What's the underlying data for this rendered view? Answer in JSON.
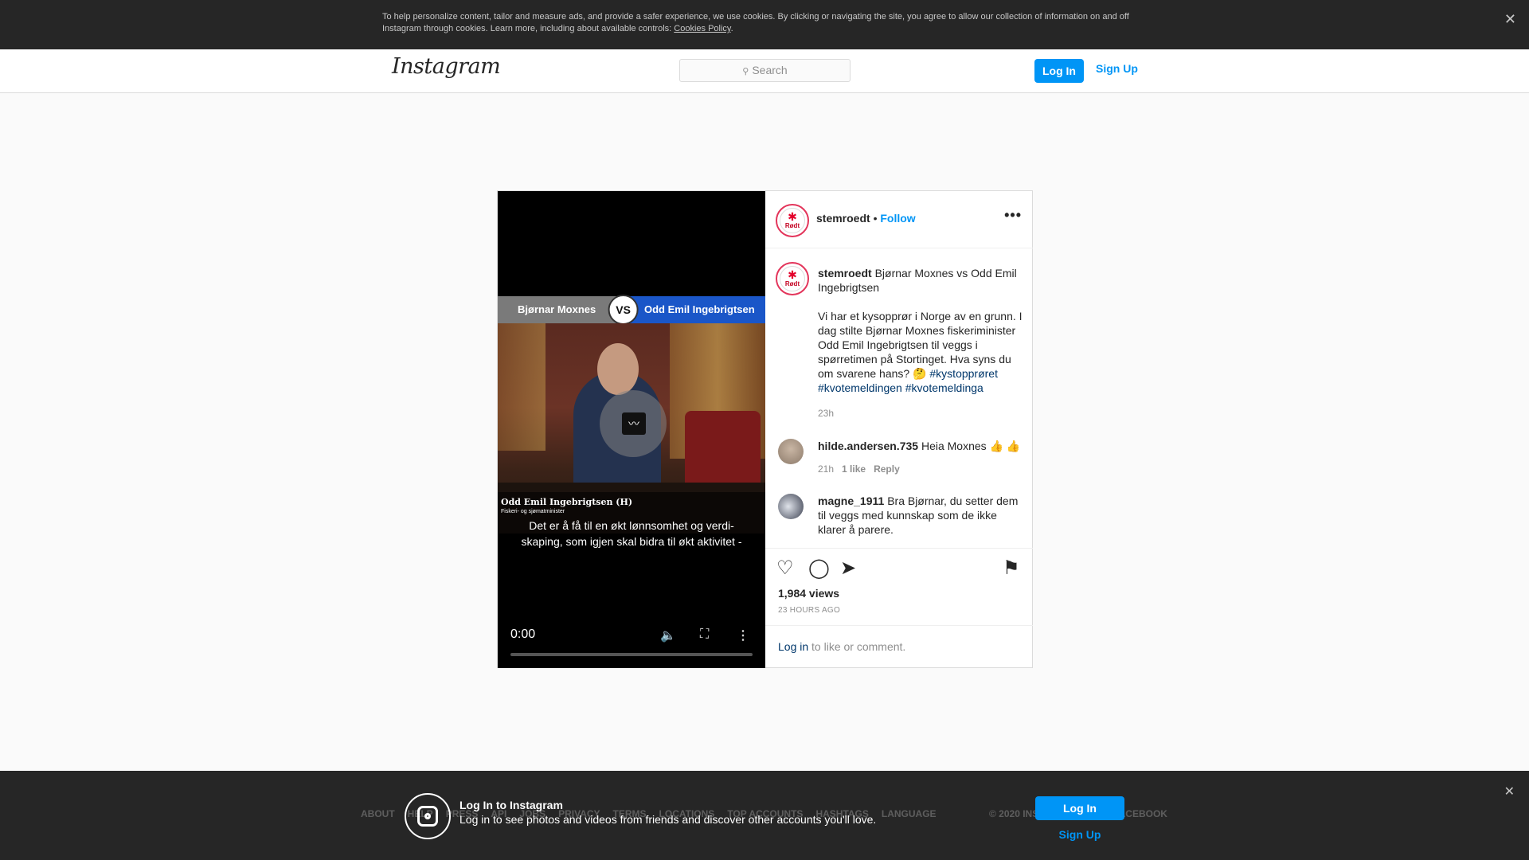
{
  "cookie_banner": {
    "text": "To help personalize content, tailor and measure ads, and provide a safer experience, we use cookies. By clicking or navigating the site, you agree to allow our collection of information on and off Instagram through cookies. Learn more, including about available controls: ",
    "link": "Cookies Policy",
    "end": ".",
    "close": "✕"
  },
  "header": {
    "logo": "Instagram",
    "search_placeholder": "Search",
    "login": "Log In",
    "signup": "Sign Up"
  },
  "video": {
    "left_name": "Bjørnar Moxnes",
    "vs": "VS",
    "right_name": "Odd Emil Ingebrigtsen",
    "lower_third_name": "Odd Emil Ingebrigtsen (H)",
    "lower_third_role": "Fiskeri- og sjømatminister",
    "subtitle": "Det er å få til en økt lønnsomhet og verdi- skaping, som igjen skal bidra til økt aktivitet -",
    "time": "0:00",
    "progress": 0
  },
  "post": {
    "username": "stemroedt",
    "separator": " • ",
    "follow": "Follow",
    "more": "•••",
    "avatar_text": "Rødt",
    "caption_title": "Bjørnar Moxnes vs Odd Emil Ingebrigtsen",
    "caption_body": "Vi har et kysopprør i Norge av en grunn. I dag stilte Bjørnar Moxnes fiskeriminister Odd Emil Ingebrigtsen til veggs i spørretimen på Stortinget. Hva syns du om svarene hans? 🤔",
    "tags": [
      "#kystopprøret",
      "#kvotemeldingen",
      "#kvotemeldinga"
    ],
    "caption_time": "23h",
    "comments": [
      {
        "user": "hilde.andersen.735",
        "text": "Heia Moxnes 👍 👍",
        "time": "21h",
        "likes": "1 like",
        "reply": "Reply"
      },
      {
        "user": "magne_1911",
        "text": "Bra Bjørnar, du setter dem til veggs med kunnskap som de ikke klarer å parere."
      }
    ],
    "views": "1,984 views",
    "ago": "23 HOURS AGO",
    "login_link": "Log in",
    "login_rest": " to like or comment."
  },
  "footer": {
    "links": [
      "ABOUT",
      "HELP",
      "PRESS",
      "API",
      "JOBS",
      "PRIVACY",
      "TERMS",
      "LOCATIONS",
      "TOP ACCOUNTS",
      "HASHTAGS",
      "LANGUAGE"
    ],
    "copyright": "© 2020 INSTAGRAM FROM FACEBOOK"
  },
  "login_banner": {
    "title": "Log In to Instagram",
    "subtitle": "Log in to see photos and videos from friends and discover other accounts you'll love.",
    "login": "Log In",
    "signup": "Sign Up",
    "close": "✕"
  },
  "colors": {
    "accent": "#0095f6",
    "link_dark": "#00376b",
    "banner_bg": "#262626"
  }
}
